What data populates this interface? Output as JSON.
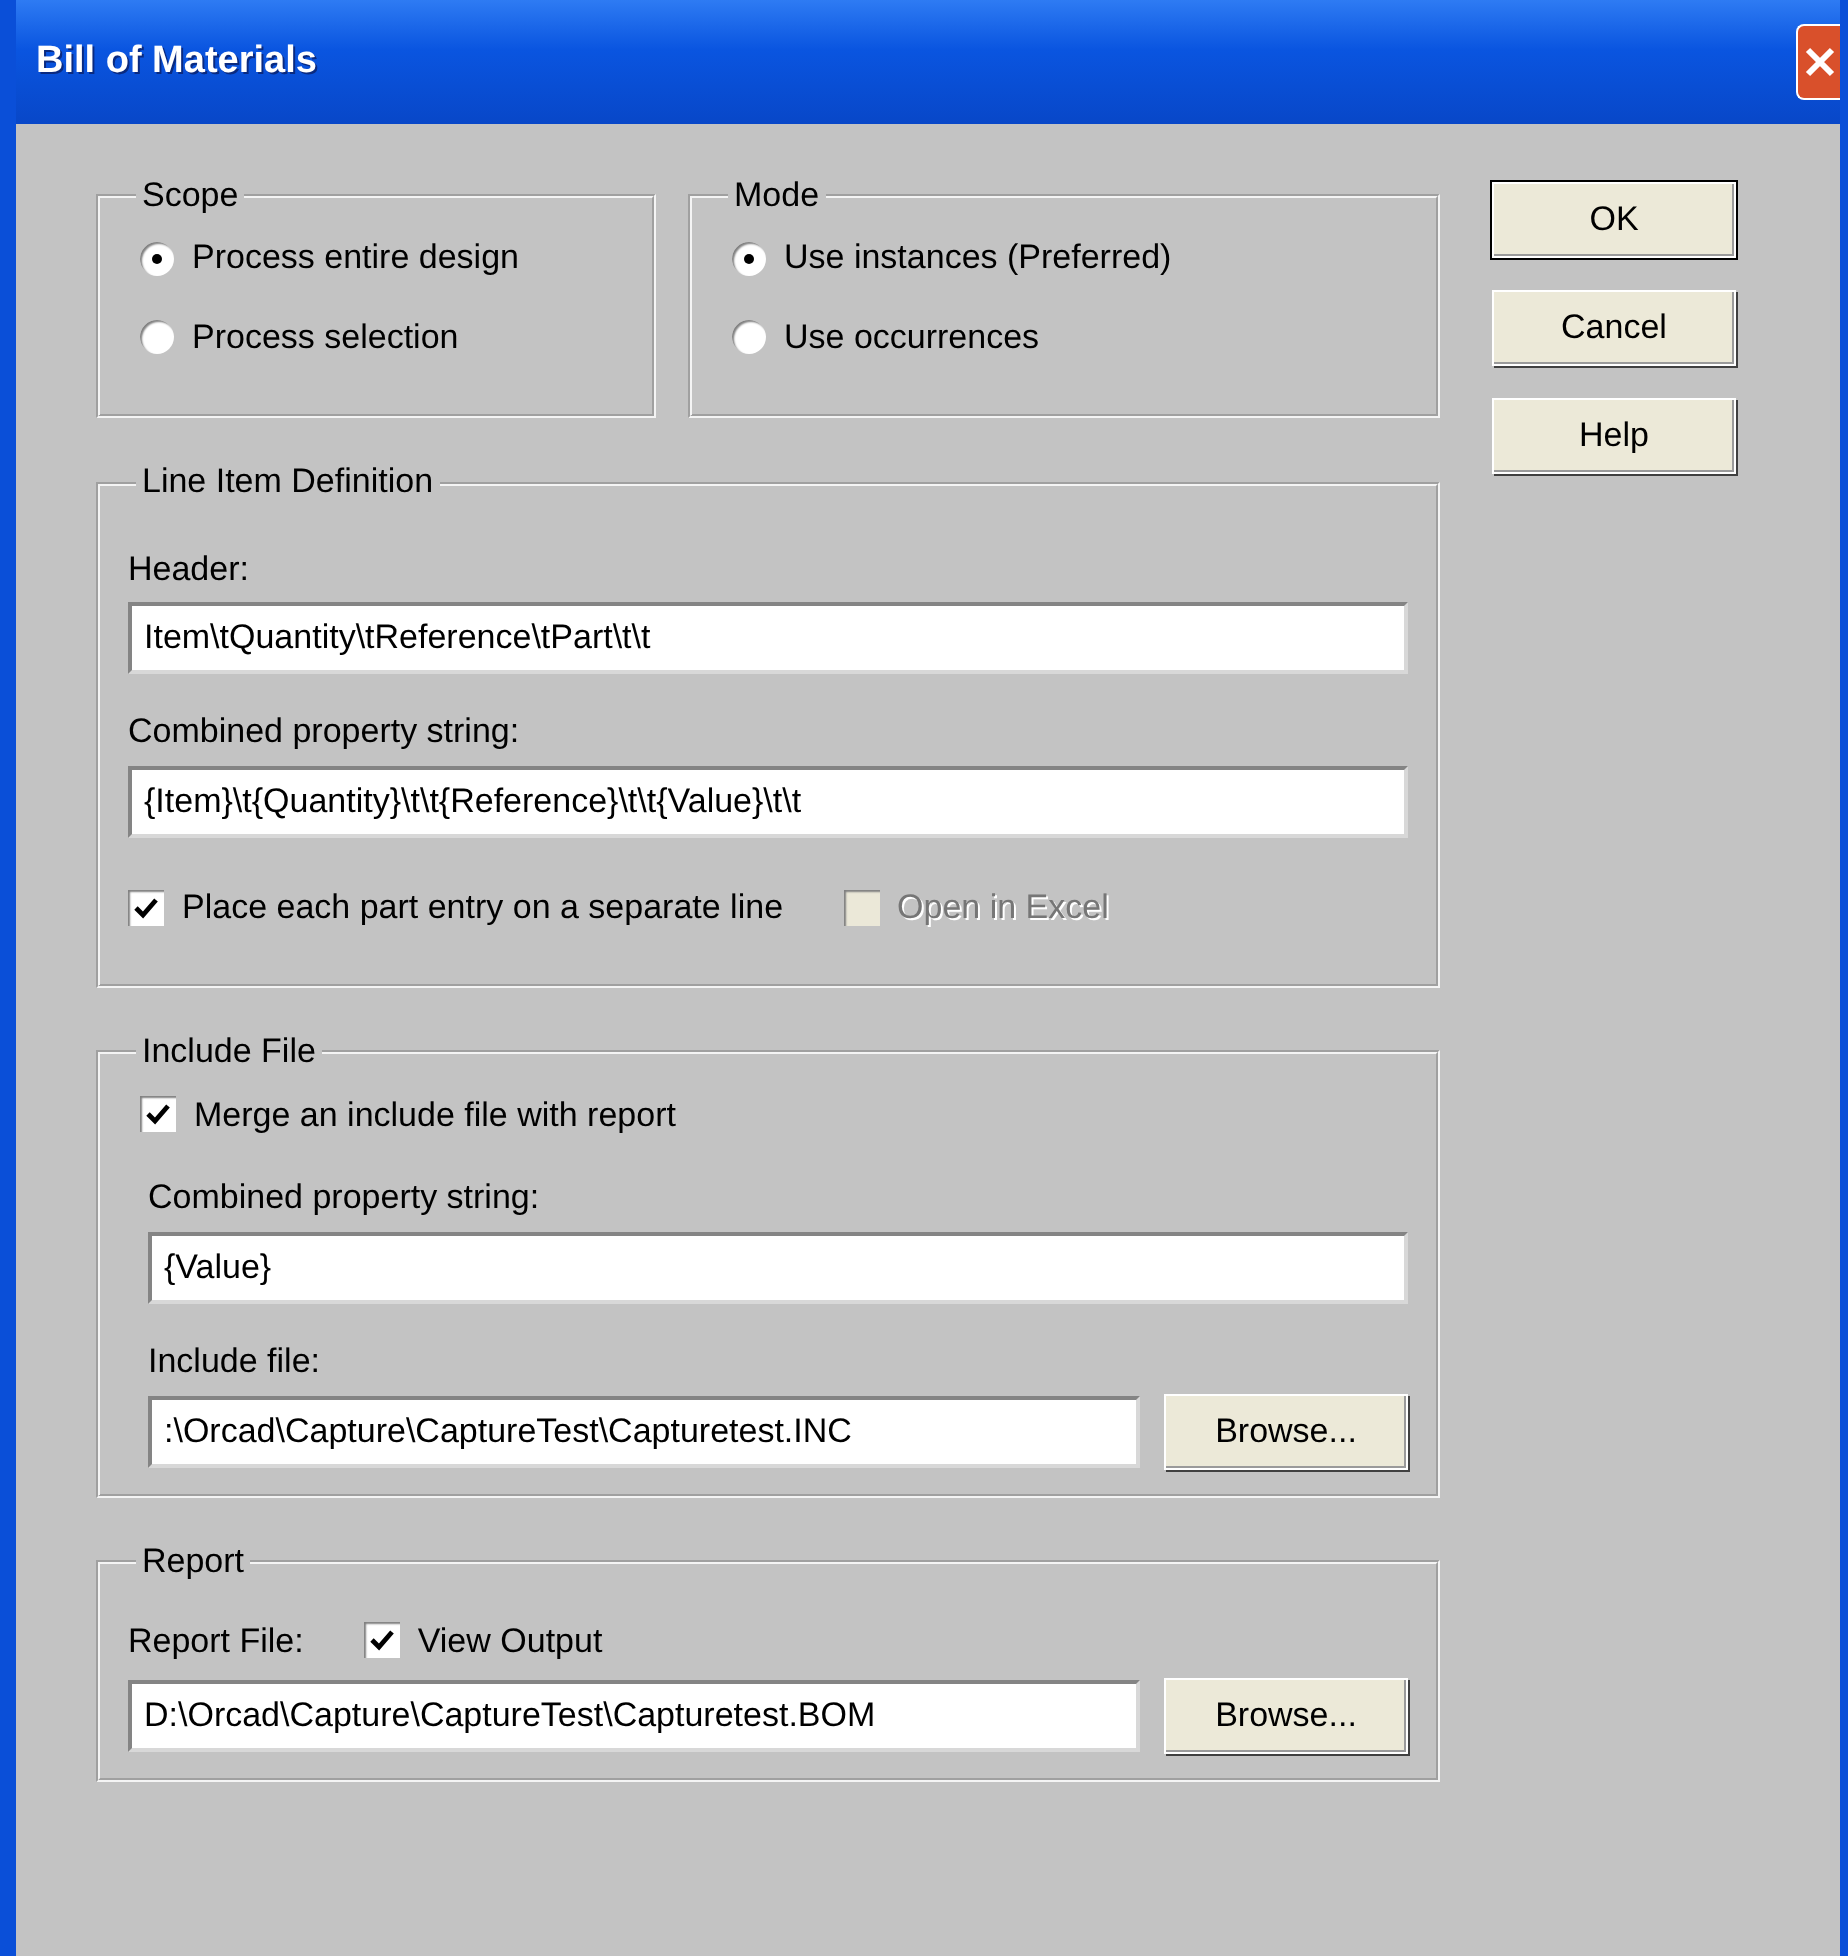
{
  "window": {
    "title": "Bill of Materials"
  },
  "scope": {
    "label": "Scope",
    "options": [
      {
        "label": "Process entire design",
        "selected": true
      },
      {
        "label": "Process selection",
        "selected": false
      }
    ]
  },
  "mode": {
    "label": "Mode",
    "options": [
      {
        "label": "Use instances (Preferred)",
        "selected": true
      },
      {
        "label": "Use occurrences",
        "selected": false
      }
    ]
  },
  "line_item_definition": {
    "label": "Line Item Definition",
    "fields": [
      {
        "label": "Header:",
        "value": "Item\\tQuantity\\tReference\\tPart\\t\\t"
      },
      {
        "label": "Combined property string:",
        "value": "{Item}\\t{Quantity}\\t\\t{Reference}\\t\\t{Value}\\t\\t"
      }
    ],
    "checkboxes": [
      {
        "label": "Place each part entry on a separate line",
        "checked": true,
        "disabled": false
      },
      {
        "label": "Open in Excel",
        "checked": false,
        "disabled": true
      }
    ]
  },
  "include_file": {
    "label": "Include File",
    "merge": {
      "label": "Merge an include file with report",
      "checked": true
    },
    "combined": {
      "label": "Combined property string:",
      "value": "{Value}"
    },
    "file": {
      "label": "Include file:",
      "value": ":\\Orcad\\Capture\\CaptureTest\\Capturetest.INC",
      "browse": "Browse..."
    }
  },
  "report": {
    "label": "Report",
    "file_label": "Report File:",
    "view_output": {
      "label": "View Output",
      "checked": true
    },
    "value": "D:\\Orcad\\Capture\\CaptureTest\\Capturetest.BOM",
    "browse": "Browse..."
  },
  "buttons": [
    {
      "label": "OK",
      "default": true
    },
    {
      "label": "Cancel",
      "default": false
    },
    {
      "label": "Help",
      "default": false
    }
  ]
}
